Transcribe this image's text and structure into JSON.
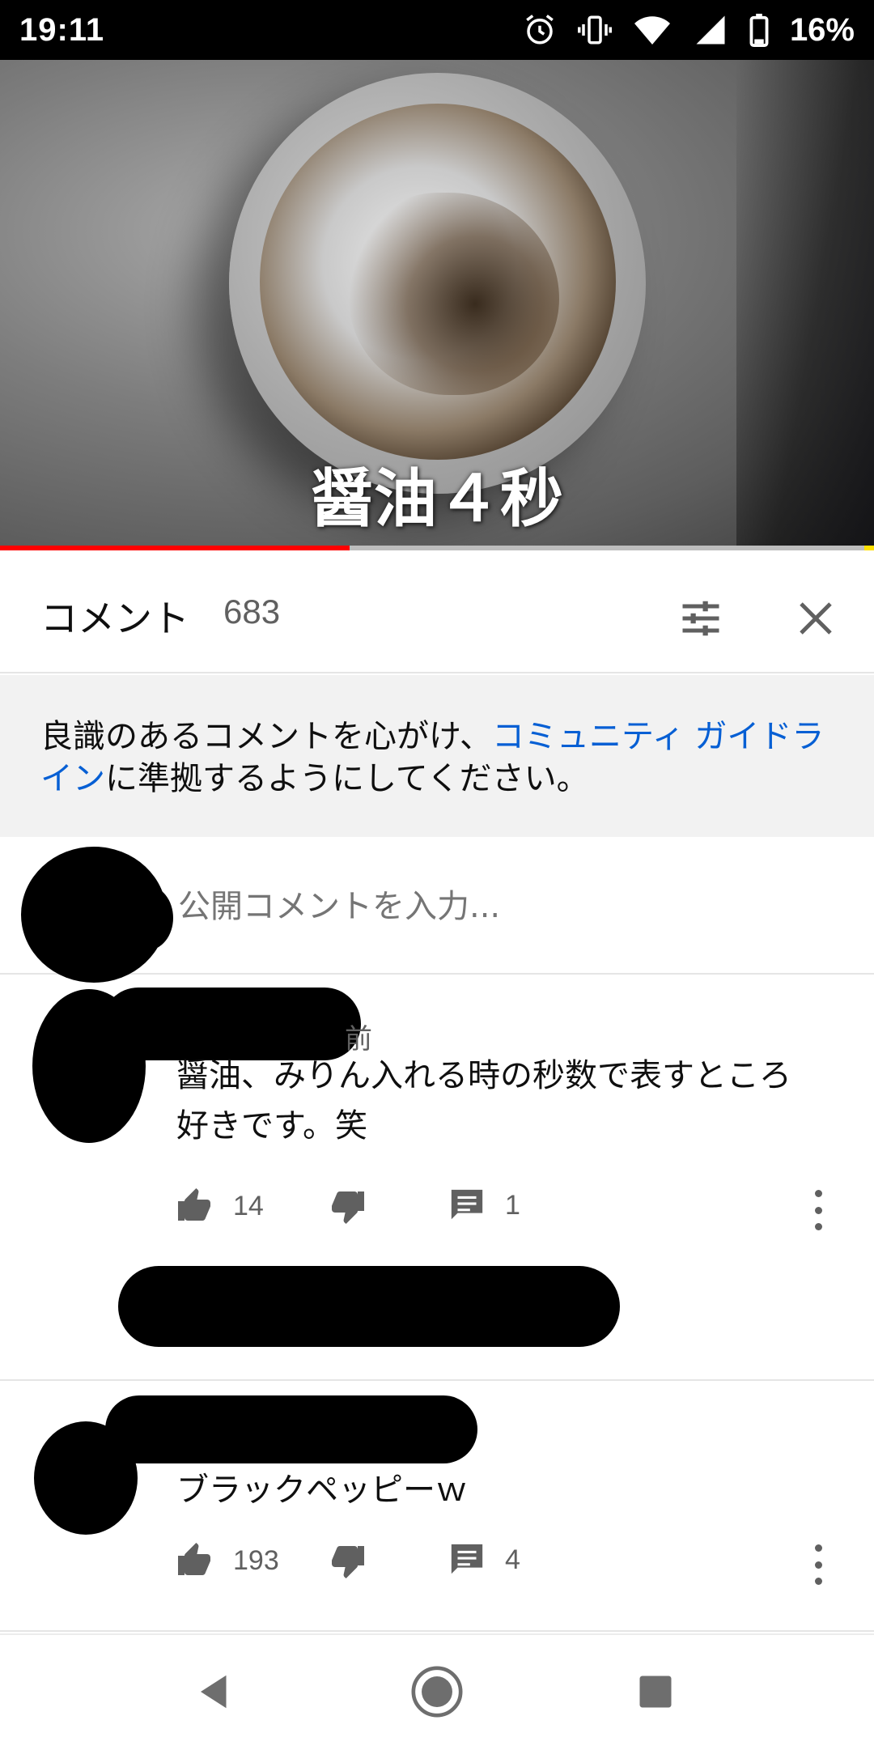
{
  "status_bar": {
    "time": "19:11",
    "battery": "16%"
  },
  "video": {
    "caption": "醤油４秒",
    "progress_fraction": 0.4
  },
  "comments_header": {
    "title": "コメント",
    "count": "683"
  },
  "guideline": {
    "text_before": "良識のあるコメントを心がけ、",
    "link_text": "コミュニティ ガイドライン",
    "text_after": "に準拠するようにしてください。"
  },
  "composer": {
    "placeholder": "公開コメントを入力..."
  },
  "comments": [
    {
      "author_meta_visible": "前",
      "text_line1": "醤油、みりん入れる時の秒数で表すところ",
      "text_line2": "好きです。笑",
      "likes": "14",
      "replies": "1"
    },
    {
      "text": "ブラックペッピーｗ",
      "likes": "193",
      "replies": "4"
    }
  ],
  "colors": {
    "accent_red": "#ff0000",
    "link_blue": "#065fd4",
    "secondary_text": "#606060"
  }
}
